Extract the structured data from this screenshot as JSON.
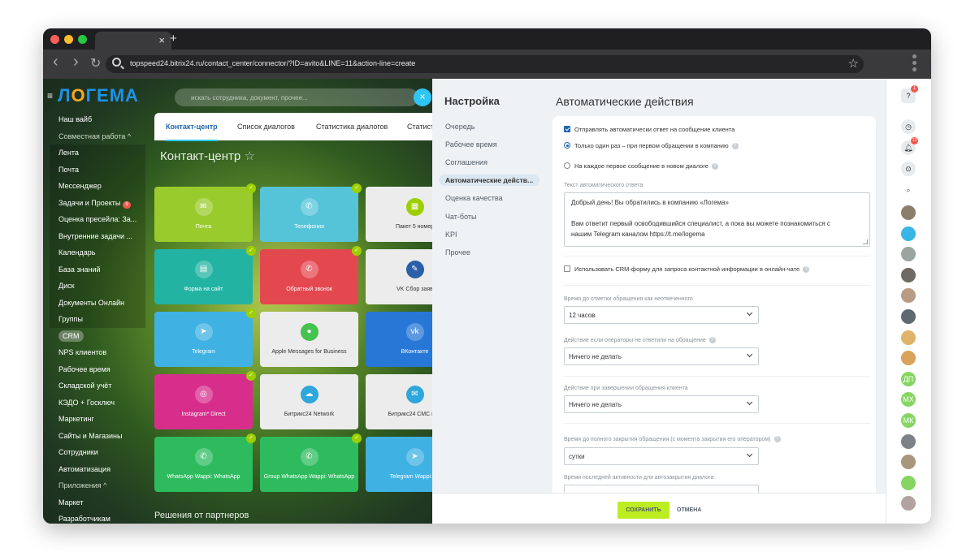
{
  "browser": {
    "url": "topspeed24.bitrix24.ru/contact_center/connector/?ID=avito&LINE=11&action-line=create",
    "tab_close": "×",
    "new_tab": "+",
    "back": "‹",
    "forward": "›",
    "reload": "↻",
    "bookmark": "☆"
  },
  "portal": {
    "logo_prefix": "Л",
    "logo_o": "О",
    "logo_suffix": "ГЕМА",
    "search_placeholder": "искать сотрудника, документ, прочее...",
    "close": "×",
    "hamburger": "≡"
  },
  "menu": [
    {
      "label": "Наш вайб"
    },
    {
      "label": "Совместная работа ^",
      "dim": true
    },
    {
      "label": "Лента",
      "sub": true
    },
    {
      "label": "Почта",
      "sub": true
    },
    {
      "label": "Мессенджер",
      "sub": true
    },
    {
      "label": "Задачи и Проекты",
      "sub": true,
      "counter": "9"
    },
    {
      "label": "Оценка пресейла: За...",
      "sub": true
    },
    {
      "label": "Внутренние задачи ...",
      "sub": true
    },
    {
      "label": "Календарь",
      "sub": true
    },
    {
      "label": "База знаний",
      "sub": true
    },
    {
      "label": "Диск",
      "sub": true
    },
    {
      "label": "Документы Онлайн",
      "sub": true
    },
    {
      "label": "Группы",
      "sub": true
    },
    {
      "label": "CRM",
      "badge": true
    },
    {
      "label": "NPS клиентов"
    },
    {
      "label": "Рабочее время"
    },
    {
      "label": "Складской учёт"
    },
    {
      "label": "КЭДО + Госключ"
    },
    {
      "label": "Маркетинг"
    },
    {
      "label": "Сайты и Магазины"
    },
    {
      "label": "Сотрудники"
    },
    {
      "label": "Автоматизация"
    },
    {
      "label": "Приложения ^",
      "dim": true
    },
    {
      "label": "Маркет"
    },
    {
      "label": "Разработчикам"
    }
  ],
  "contact_tabs": [
    "Контакт-центр",
    "Список диалогов",
    "Статистика диалогов",
    "Статисти"
  ],
  "page_title": "Контакт-центр",
  "page_title_star": "☆",
  "tiles": [
    {
      "label": "Почта",
      "icon": "✉",
      "color": "#9acb2c",
      "check": true
    },
    {
      "label": "Телефония",
      "icon": "✆",
      "color": "#55c4d8",
      "check": true
    },
    {
      "label": "Пакет 5 номер",
      "icon": "▦",
      "color": "#ececec",
      "dark": true,
      "iconbg": "#9dcf00"
    },
    {
      "label": "Форма на сайт",
      "icon": "▤",
      "color": "#23b3a3",
      "check": true
    },
    {
      "label": "Обратный звонок",
      "icon": "✆",
      "color": "#e4484f",
      "check": true
    },
    {
      "label": "VK Сбор заяв",
      "icon": "✎",
      "color": "#ececec",
      "dark": true,
      "iconbg": "#2a5fa8"
    },
    {
      "label": "Telegram",
      "icon": "➤",
      "color": "#3fb1e3",
      "check": true
    },
    {
      "label": "Apple Messages for Business",
      "icon": "●",
      "color": "#ececec",
      "dark": true,
      "iconbg": "#45c24f"
    },
    {
      "label": "ВКонтакте",
      "icon": "vk",
      "color": "#2777d6"
    },
    {
      "label": "Instagram* Direct",
      "icon": "◎",
      "color": "#d72e8c",
      "check": true
    },
    {
      "label": "Битрикс24 Network",
      "icon": "☁",
      "color": "#ececec",
      "dark": true,
      "iconbg": "#2fa6dc"
    },
    {
      "label": "Битрикс24 СМС и W",
      "icon": "✉",
      "color": "#ececec",
      "dark": true,
      "iconbg": "#2fa6dc"
    },
    {
      "label": "WhatsApp Wappi: WhatsApp",
      "icon": "✆",
      "color": "#2dbb5e",
      "check": true
    },
    {
      "label": "Group WhatsApp Wappi: WhatsApp",
      "icon": "✆",
      "color": "#2dbb5e",
      "check": true
    },
    {
      "label": "Telegram Wappi: Te",
      "icon": "➤",
      "color": "#3fb1e3"
    }
  ],
  "partners_title": "Решения от партнеров",
  "settings": {
    "sidebar_title": "Настройка",
    "sidebar_items": [
      "Очередь",
      "Рабочее время",
      "Соглашения",
      "Автоматические действ...",
      "Оценка качества",
      "Чат-боты",
      "KPI",
      "Прочее"
    ],
    "active_index": 3,
    "title": "Автоматические действия",
    "auto_reply_label": "Отправлять автоматически ответ на сообщение клиента",
    "auto_reply_checked": true,
    "radio_once": "Только один раз – при первом обращении в компанию",
    "radio_each": "На каждое первое сообщение в новом диалоге",
    "reply_text_label": "Текст автоматического ответа",
    "reply_text_line1": "Добрый день! Вы обратились в компанию «Логема»",
    "reply_text_line2": "Вам ответит первый освободившийся специалист, а пока вы можете познакомиться с",
    "reply_text_line3": "нашим Telegram каналом https://t.me/logema",
    "crm_form_label": "Использовать CRM-форму для запроса контактной информации в онлайн-чате",
    "crm_form_checked": false,
    "unanswered_label": "Время до отметки обращения как неотвеченного",
    "unanswered_value": "12 часов",
    "no_answer_action_label": "Действие если операторы не ответили на обращение",
    "no_answer_action_value": "Ничего не делать",
    "finish_action_label": "Действие при завершении обращения клиента",
    "finish_action_value": "Ничего не делать",
    "full_close_label": "Время до полного закрытия обращения (с момента закрытия его оператором)",
    "full_close_value": "сутки",
    "last_activity_label": "Время последней активности для автозакрытия диалога",
    "help": "?",
    "save": "СОХРАНИТЬ",
    "cancel": "ОТМЕНА"
  },
  "right_bar": {
    "help_badge": "1",
    "bell_badge": "13",
    "avatars": [
      {
        "text": "",
        "color": "#8d7e6c"
      },
      {
        "text": "",
        "color": "#38b7e6"
      },
      {
        "text": "",
        "color": "#9aa5a0"
      },
      {
        "text": "",
        "color": "#6f6a64"
      },
      {
        "text": "",
        "color": "#b79b84"
      },
      {
        "text": "",
        "color": "#5d6a72"
      },
      {
        "text": "",
        "color": "#e0b36b"
      },
      {
        "text": "",
        "color": "#d9a35b"
      },
      {
        "text": "ДП",
        "color": "#86d563"
      },
      {
        "text": "МХ",
        "color": "#86d563"
      },
      {
        "text": "МК",
        "color": "#86d563"
      },
      {
        "text": "",
        "color": "#7d8188"
      },
      {
        "text": "",
        "color": "#a9967f"
      },
      {
        "text": "",
        "color": "#86d563"
      },
      {
        "text": "",
        "color": "#b3a3a0"
      }
    ]
  }
}
